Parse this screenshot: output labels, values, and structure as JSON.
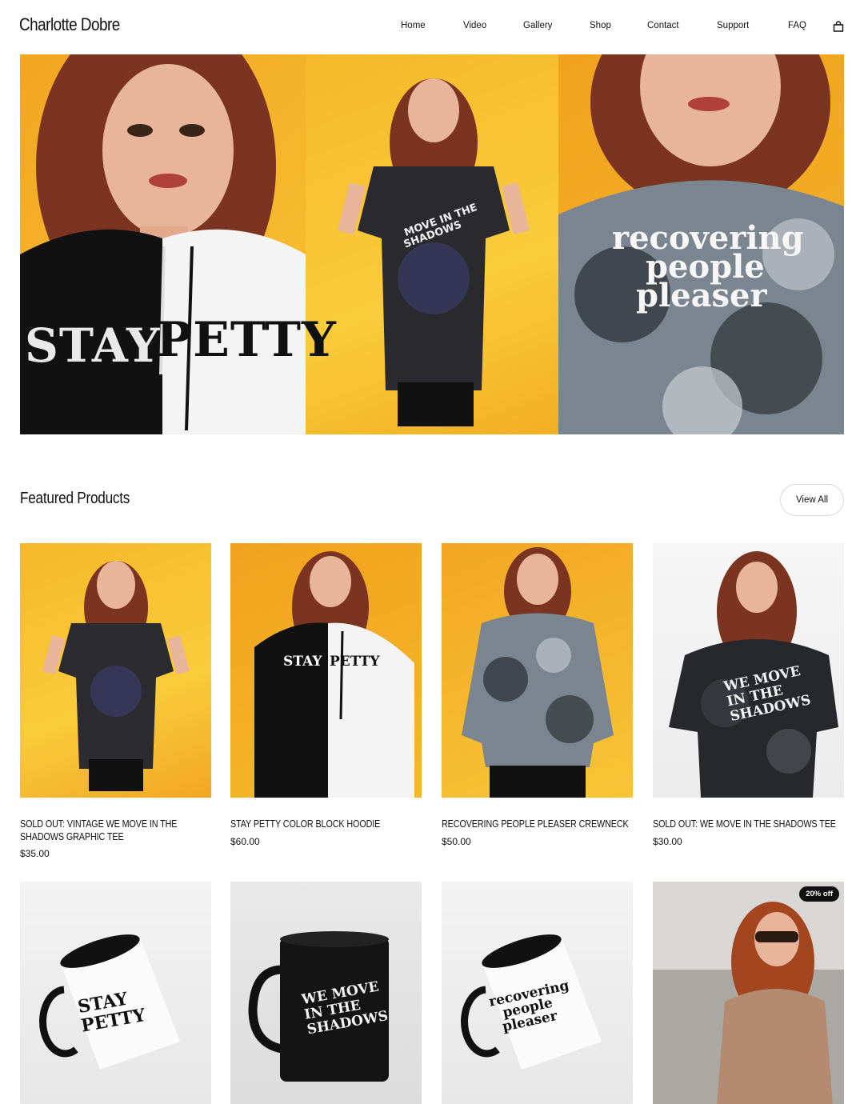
{
  "site": {
    "brand": "Charlotte Dobre",
    "nav": [
      "Home",
      "Video",
      "Gallery",
      "Shop",
      "Contact",
      "Support",
      "FAQ"
    ],
    "cart_icon": "shopping-bag-icon"
  },
  "hero": {
    "panels": [
      {
        "shirt_text": [
          "STAY",
          "PETTY"
        ]
      },
      {
        "shirt_text": [
          "MOVE IN THE",
          "SHADOWS"
        ]
      },
      {
        "shirt_text": [
          "recovering",
          "people",
          "pleaser"
        ]
      }
    ]
  },
  "featured": {
    "title": "Featured Products",
    "view_all": "View All",
    "products": [
      {
        "name": "SOLD OUT: VINTAGE WE MOVE IN THE SHADOWS GRAPHIC TEE",
        "price": "$35.00"
      },
      {
        "name": "STAY PETTY COLOR BLOCK HOODIE",
        "price": "$60.00"
      },
      {
        "name": "RECOVERING PEOPLE PLEASER CREWNECK",
        "price": "$50.00"
      },
      {
        "name": "SOLD OUT: WE MOVE IN THE SHADOWS TEE",
        "price": "$30.00"
      }
    ],
    "row2": [
      {
        "mug_text": [
          "STAY",
          "PETTY"
        ]
      },
      {
        "mug_text": [
          "WE MOVE",
          "IN THE",
          "SHADOWS"
        ]
      },
      {
        "mug_text": [
          "recovering",
          "people",
          "pleaser"
        ]
      },
      {
        "badge": "20% off"
      }
    ]
  },
  "colors": {
    "accent_yellow": "#f5b42a",
    "text": "#111111",
    "badge_bg": "#111111"
  }
}
